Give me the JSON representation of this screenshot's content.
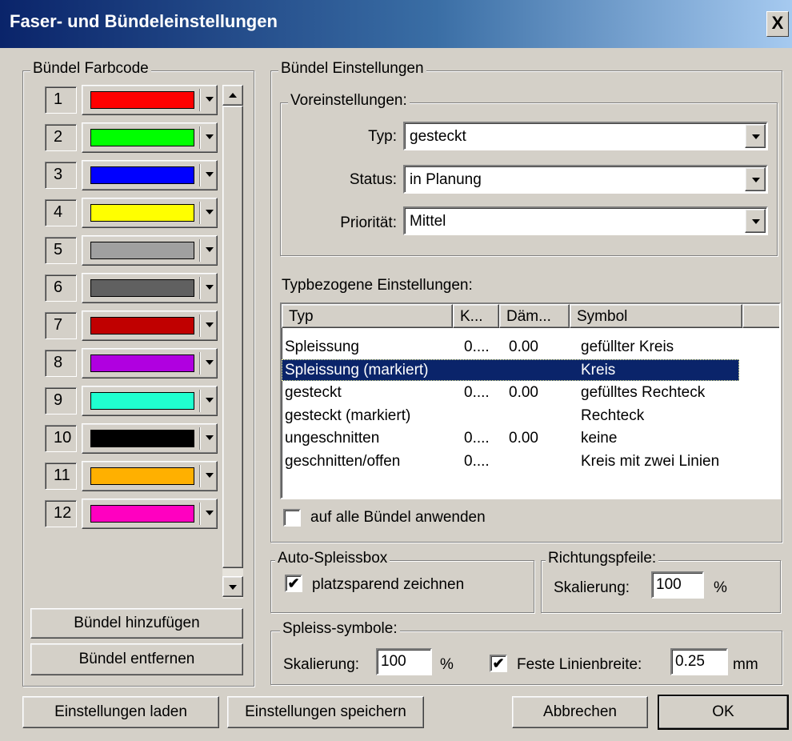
{
  "window": {
    "title": "Faser- und Bündeleinstellungen",
    "close_label": "X"
  },
  "bundle_colors": {
    "legend": "Bündel Farbcode",
    "items": [
      {
        "num": "1",
        "color": "#ff0000"
      },
      {
        "num": "2",
        "color": "#00ff00"
      },
      {
        "num": "3",
        "color": "#0000ff"
      },
      {
        "num": "4",
        "color": "#ffff00"
      },
      {
        "num": "5",
        "color": "#a0a0a0"
      },
      {
        "num": "6",
        "color": "#606060"
      },
      {
        "num": "7",
        "color": "#c00000"
      },
      {
        "num": "8",
        "color": "#b000e0"
      },
      {
        "num": "9",
        "color": "#20ffd0"
      },
      {
        "num": "10",
        "color": "#000000"
      },
      {
        "num": "11",
        "color": "#ffb000"
      },
      {
        "num": "12",
        "color": "#ff00c0"
      }
    ],
    "add_button": "Bündel hinzufügen",
    "remove_button": "Bündel entfernen"
  },
  "bundle_settings": {
    "legend": "Bündel Einstellungen",
    "presets": {
      "legend": "Voreinstellungen:",
      "typ_label": "Typ:",
      "typ_value": "gesteckt",
      "status_label": "Status:",
      "status_value": "in Planung",
      "prio_label": "Priorität:",
      "prio_value": "Mittel"
    },
    "type_settings": {
      "label": "Typbezogene Einstellungen:",
      "columns": [
        "Typ",
        "K...",
        "Däm...",
        "Symbol"
      ],
      "rows": [
        {
          "typ": "Spleissung",
          "k": "0....",
          "daem": "0.00",
          "symbol": "gefüllter Kreis"
        },
        {
          "typ": "Spleissung (markiert)",
          "k": "",
          "daem": "",
          "symbol": "Kreis"
        },
        {
          "typ": "gesteckt",
          "k": "0....",
          "daem": "0.00",
          "symbol": "gefülltes Rechteck"
        },
        {
          "typ": "gesteckt (markiert)",
          "k": "",
          "daem": "",
          "symbol": "Rechteck"
        },
        {
          "typ": "ungeschnitten",
          "k": "0....",
          "daem": "0.00",
          "symbol": "keine"
        },
        {
          "typ": "geschnitten/offen",
          "k": "0....",
          "daem": "",
          "symbol": "Kreis mit zwei Linien"
        }
      ],
      "selected_row": 1
    },
    "apply_all_label": "auf alle Bündel anwenden",
    "apply_all_checked": false
  },
  "auto_splice": {
    "legend": "Auto-Spleissbox",
    "checkbox_label": "platzsparend zeichnen",
    "checked": true
  },
  "arrows": {
    "legend": "Richtungspfeile:",
    "scale_label": "Skalierung:",
    "scale_value": "100",
    "unit": "%"
  },
  "splice_symbols": {
    "legend": "Spleiss-symbole:",
    "scale_label": "Skalierung:",
    "scale_value": "100",
    "scale_unit": "%",
    "fixed_width_label": "Feste Linienbreite:",
    "fixed_width_checked": true,
    "width_value": "0.25",
    "width_unit": "mm"
  },
  "footer": {
    "load": "Einstellungen laden",
    "save": "Einstellungen speichern",
    "cancel": "Abbrechen",
    "ok": "OK"
  }
}
